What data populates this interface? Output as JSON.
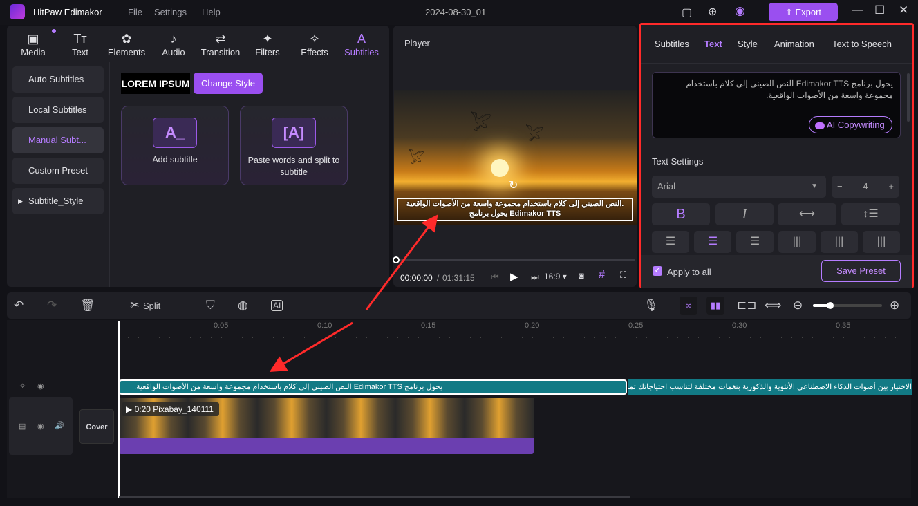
{
  "app": {
    "title": "HitPaw Edimakor",
    "menu": [
      "File",
      "Settings",
      "Help"
    ],
    "project": "2024-08-30_01",
    "export": "Export"
  },
  "tabs": [
    {
      "label": "Media",
      "icon": "media-icon"
    },
    {
      "label": "Text",
      "icon": "text-icon"
    },
    {
      "label": "Elements",
      "icon": "elements-icon"
    },
    {
      "label": "Audio",
      "icon": "audio-icon"
    },
    {
      "label": "Transition",
      "icon": "transition-icon"
    },
    {
      "label": "Filters",
      "icon": "filters-icon"
    },
    {
      "label": "Effects",
      "icon": "effects-icon"
    },
    {
      "label": "Subtitles",
      "icon": "subtitles-icon",
      "active": true
    }
  ],
  "sidebar": [
    "Auto Subtitles",
    "Local Subtitles",
    "Manual Subt...",
    "Custom Preset",
    "Subtitle_Style"
  ],
  "content": {
    "preset_sample": "LOREM IPSUM",
    "change_style": "Change Style",
    "add_subtitle": "Add subtitle",
    "paste_split": "Paste words and split to subtitle"
  },
  "player": {
    "title": "Player",
    "caption_line1": "النص الصيني إلى كلام باستخدام مجموعة واسعة من الأصوات الواقعية.",
    "caption_line2": "يحول برنامج Edimakor TTS",
    "time_current": "00:00:00",
    "time_total": "01:31:15",
    "ratio": "16:9"
  },
  "right": {
    "tabs": [
      "Subtitles",
      "Text",
      "Style",
      "Animation",
      "Text to Speech"
    ],
    "active_tab": "Text",
    "text_value": "يحول برنامج Edimakor TTS النص الصيني إلى كلام باستخدام مجموعة واسعة من الأصوات الواقعية.",
    "ai_copywriting": "AI Copywriting",
    "text_settings": "Text Settings",
    "font": "Arial",
    "size": "4",
    "apply_all": "Apply to all",
    "apply_all_checked": true,
    "save_preset": "Save Preset"
  },
  "timeline": {
    "split": "Split",
    "ruler": [
      "0:05",
      "0:10",
      "0:15",
      "0:20",
      "0:25",
      "0:30",
      "0:35"
    ],
    "sub1": "يحول برنامج Edimakor TTS النص الصيني إلى كلام باستخدام مجموعة واسعة من الأصوات الواقعية.",
    "sub2": "الاختيار بين أصوات الذكاء الاصطناعي الأنثوية والذكورية بنغمات مختلفة لتناسب احتياجاتك تمامًا.",
    "clip": "0:20 Pixabay_140111",
    "cover": "Cover",
    "zoom_level": 0.25
  },
  "colors": {
    "accent": "#a25cf0",
    "subtitle_track": "#127a85",
    "highlight": "#ff2a2a"
  }
}
